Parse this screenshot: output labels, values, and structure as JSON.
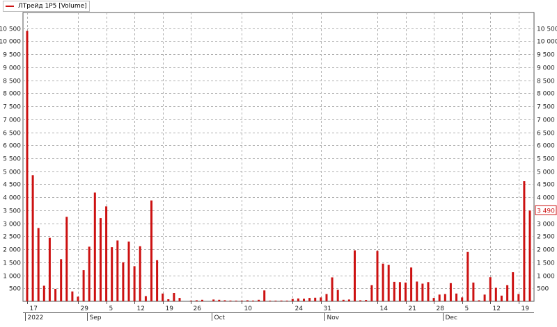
{
  "legend": {
    "label": "ЛТрейд 1Р5 [Volume]",
    "color": "#cc1111"
  },
  "current_value_label": "3 490",
  "colors": {
    "bar": "#cc1111",
    "grid": "#b0b0b0",
    "axis": "#555555",
    "plot_bg": "#ffffff",
    "badge_text": "#cc1111"
  },
  "chart_data": {
    "type": "bar",
    "title": "",
    "series": [
      {
        "name": "ЛТрейд 1Р5 [Volume]",
        "values": [
          10400,
          4850,
          2820,
          600,
          2440,
          480,
          1620,
          3250,
          380,
          180,
          1200,
          2100,
          4180,
          3200,
          3650,
          2080,
          2340,
          1500,
          2300,
          1350,
          2120,
          200,
          3880,
          1580,
          300,
          80,
          320,
          130,
          0,
          20,
          40,
          60,
          0,
          70,
          60,
          40,
          30,
          20,
          20,
          40,
          30,
          60,
          420,
          20,
          10,
          30,
          20,
          90,
          110,
          100,
          130,
          140,
          150,
          280,
          920,
          440,
          60,
          70,
          1960,
          40,
          50,
          620,
          1940,
          1450,
          1400,
          750,
          740,
          720,
          1300,
          760,
          680,
          740,
          130,
          260,
          280,
          700,
          300,
          150,
          1900,
          720,
          40,
          260,
          930,
          520,
          220,
          620,
          1120,
          280,
          4620,
          3490
        ]
      }
    ],
    "ylim": [
      0,
      11000
    ],
    "y_ticks": [
      500,
      1000,
      1500,
      2000,
      2500,
      3000,
      3500,
      4000,
      4500,
      5000,
      5500,
      6000,
      6500,
      7000,
      7500,
      8000,
      8500,
      9000,
      9500,
      10000,
      10500
    ],
    "y_tick_labels": [
      "500",
      "1 000",
      "1 500",
      "2 000",
      "2 500",
      "3 000",
      "3 500",
      "4 000",
      "4 500",
      "5 000",
      "5 500",
      "6 000",
      "6 500",
      "7 000",
      "7 500",
      "8 000",
      "8 500",
      "9 000",
      "9 500",
      "10 000",
      "10 500"
    ],
    "x_ticks": [
      {
        "index": 0,
        "label": "17"
      },
      {
        "index": 9,
        "label": "29"
      },
      {
        "index": 14,
        "label": "5"
      },
      {
        "index": 19,
        "label": "12"
      },
      {
        "index": 24,
        "label": "19"
      },
      {
        "index": 29,
        "label": "26"
      },
      {
        "index": 38,
        "label": "10"
      },
      {
        "index": 47,
        "label": "24"
      },
      {
        "index": 52,
        "label": "31"
      },
      {
        "index": 62,
        "label": "14"
      },
      {
        "index": 67,
        "label": "21"
      },
      {
        "index": 72,
        "label": "28"
      },
      {
        "index": 77,
        "label": "5"
      },
      {
        "index": 82,
        "label": "12"
      },
      {
        "index": 87,
        "label": "19"
      }
    ],
    "period_labels": [
      {
        "index": 0,
        "label": "2022"
      },
      {
        "index": 11,
        "label": "Sep"
      },
      {
        "index": 33,
        "label": "Oct"
      },
      {
        "index": 53,
        "label": "Nov"
      },
      {
        "index": 74,
        "label": "Dec"
      }
    ],
    "grid": true
  }
}
